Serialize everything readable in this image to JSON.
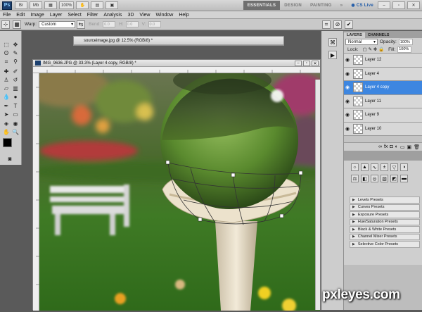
{
  "appbar": {
    "logo": "Ps",
    "zoom": "100%",
    "workspaces": [
      "ESSENTIALS",
      "DESIGN",
      "PAINTING"
    ],
    "cs_live": "CS Live"
  },
  "menu": [
    "File",
    "Edit",
    "Image",
    "Layer",
    "Select",
    "Filter",
    "Analysis",
    "3D",
    "View",
    "Window",
    "Help"
  ],
  "options": {
    "warp_label": "Warp:",
    "warp_value": "Custom",
    "bend_label": "Bend:",
    "bend_value": "0.0",
    "h_label": "H:",
    "h_value": "0.0",
    "v_label": "V:",
    "v_value": "0.0"
  },
  "documents": {
    "back_title": "sourceimage.jpg @ 12.5% (RGB/8) *",
    "front_title": "IMG_9636.JPG @ 33.3% (Layer 4 copy, RGB/8) *"
  },
  "panels": {
    "tabs": [
      "LAYERS",
      "CHANNELS"
    ],
    "blend_mode": "Normal",
    "opacity_label": "Opacity:",
    "opacity_value": "100%",
    "lock_label": "Lock:",
    "fill_label": "Fill:",
    "fill_value": "100%",
    "layers": [
      {
        "name": "Layer 12",
        "selected": false
      },
      {
        "name": "Layer 4",
        "selected": false
      },
      {
        "name": "Layer 4 copy",
        "selected": true
      },
      {
        "name": "Layer 11",
        "selected": false
      },
      {
        "name": "Layer 9",
        "selected": false
      },
      {
        "name": "Layer 10",
        "selected": false
      }
    ],
    "presets": [
      "Levels Presets",
      "Curves Presets",
      "Exposure Presets",
      "Hue/Saturation Presets",
      "Black & White Presets",
      "Channel Mixer Presets",
      "Selective Color Presets"
    ]
  },
  "watermark": "pxleyes.com",
  "colors": {
    "selected_layer": "#3d86e0",
    "ui_gray": "#cbcbcb"
  }
}
